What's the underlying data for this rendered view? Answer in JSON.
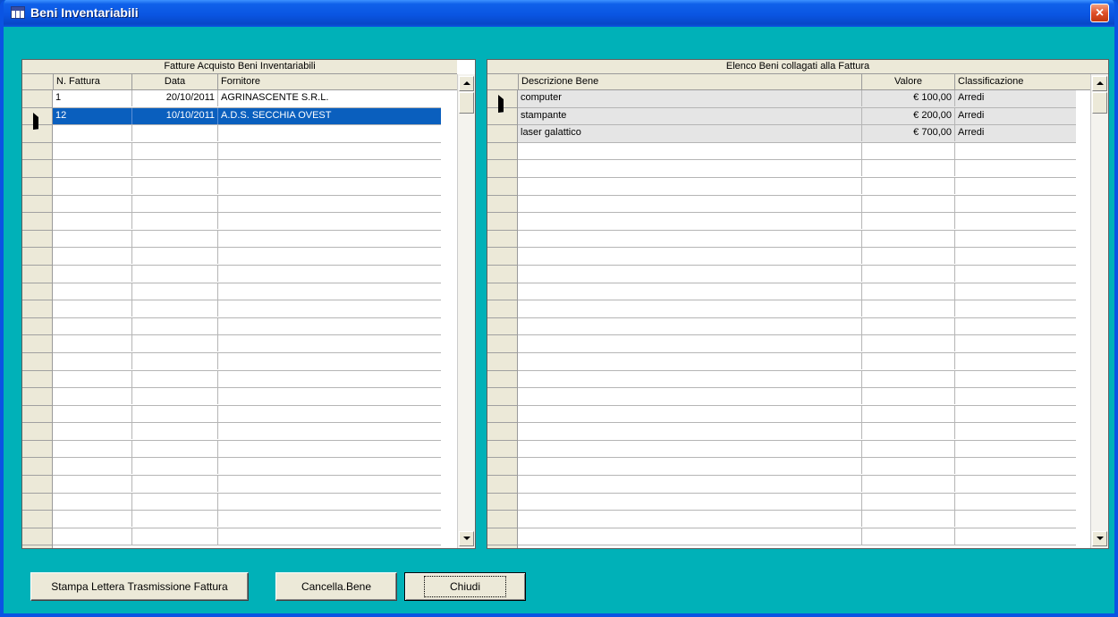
{
  "window": {
    "title": "Beni Inventariabili",
    "close_label": "×"
  },
  "left_grid": {
    "caption": "Fatture Acquisto Beni Inventariabili",
    "columns": [
      "N. Fattura",
      "Data",
      "Fornitore"
    ],
    "rows": [
      {
        "num": "1",
        "date": "20/10/2011",
        "supplier": "AGRINASCENTE S.R.L."
      },
      {
        "num": "12",
        "date": "10/10/2011",
        "supplier": "A.D.S. SECCHIA OVEST"
      }
    ],
    "selected_row": 1
  },
  "right_grid": {
    "caption": "Elenco Beni collagati alla Fattura",
    "columns": [
      "Descrizione Bene",
      "Valore",
      "Classificazione"
    ],
    "rows": [
      {
        "desc": "computer",
        "value": "€ 100,00",
        "class": "Arredi"
      },
      {
        "desc": "stampante",
        "value": "€ 200,00",
        "class": "Arredi"
      },
      {
        "desc": "laser galattico",
        "value": "€ 700,00",
        "class": "Arredi"
      }
    ],
    "current_row": 0
  },
  "buttons": {
    "stampa": "Stampa Lettera Trasmissione Fattura",
    "cancella": "Cancella.Bene",
    "chiudi": "Chiudi"
  }
}
